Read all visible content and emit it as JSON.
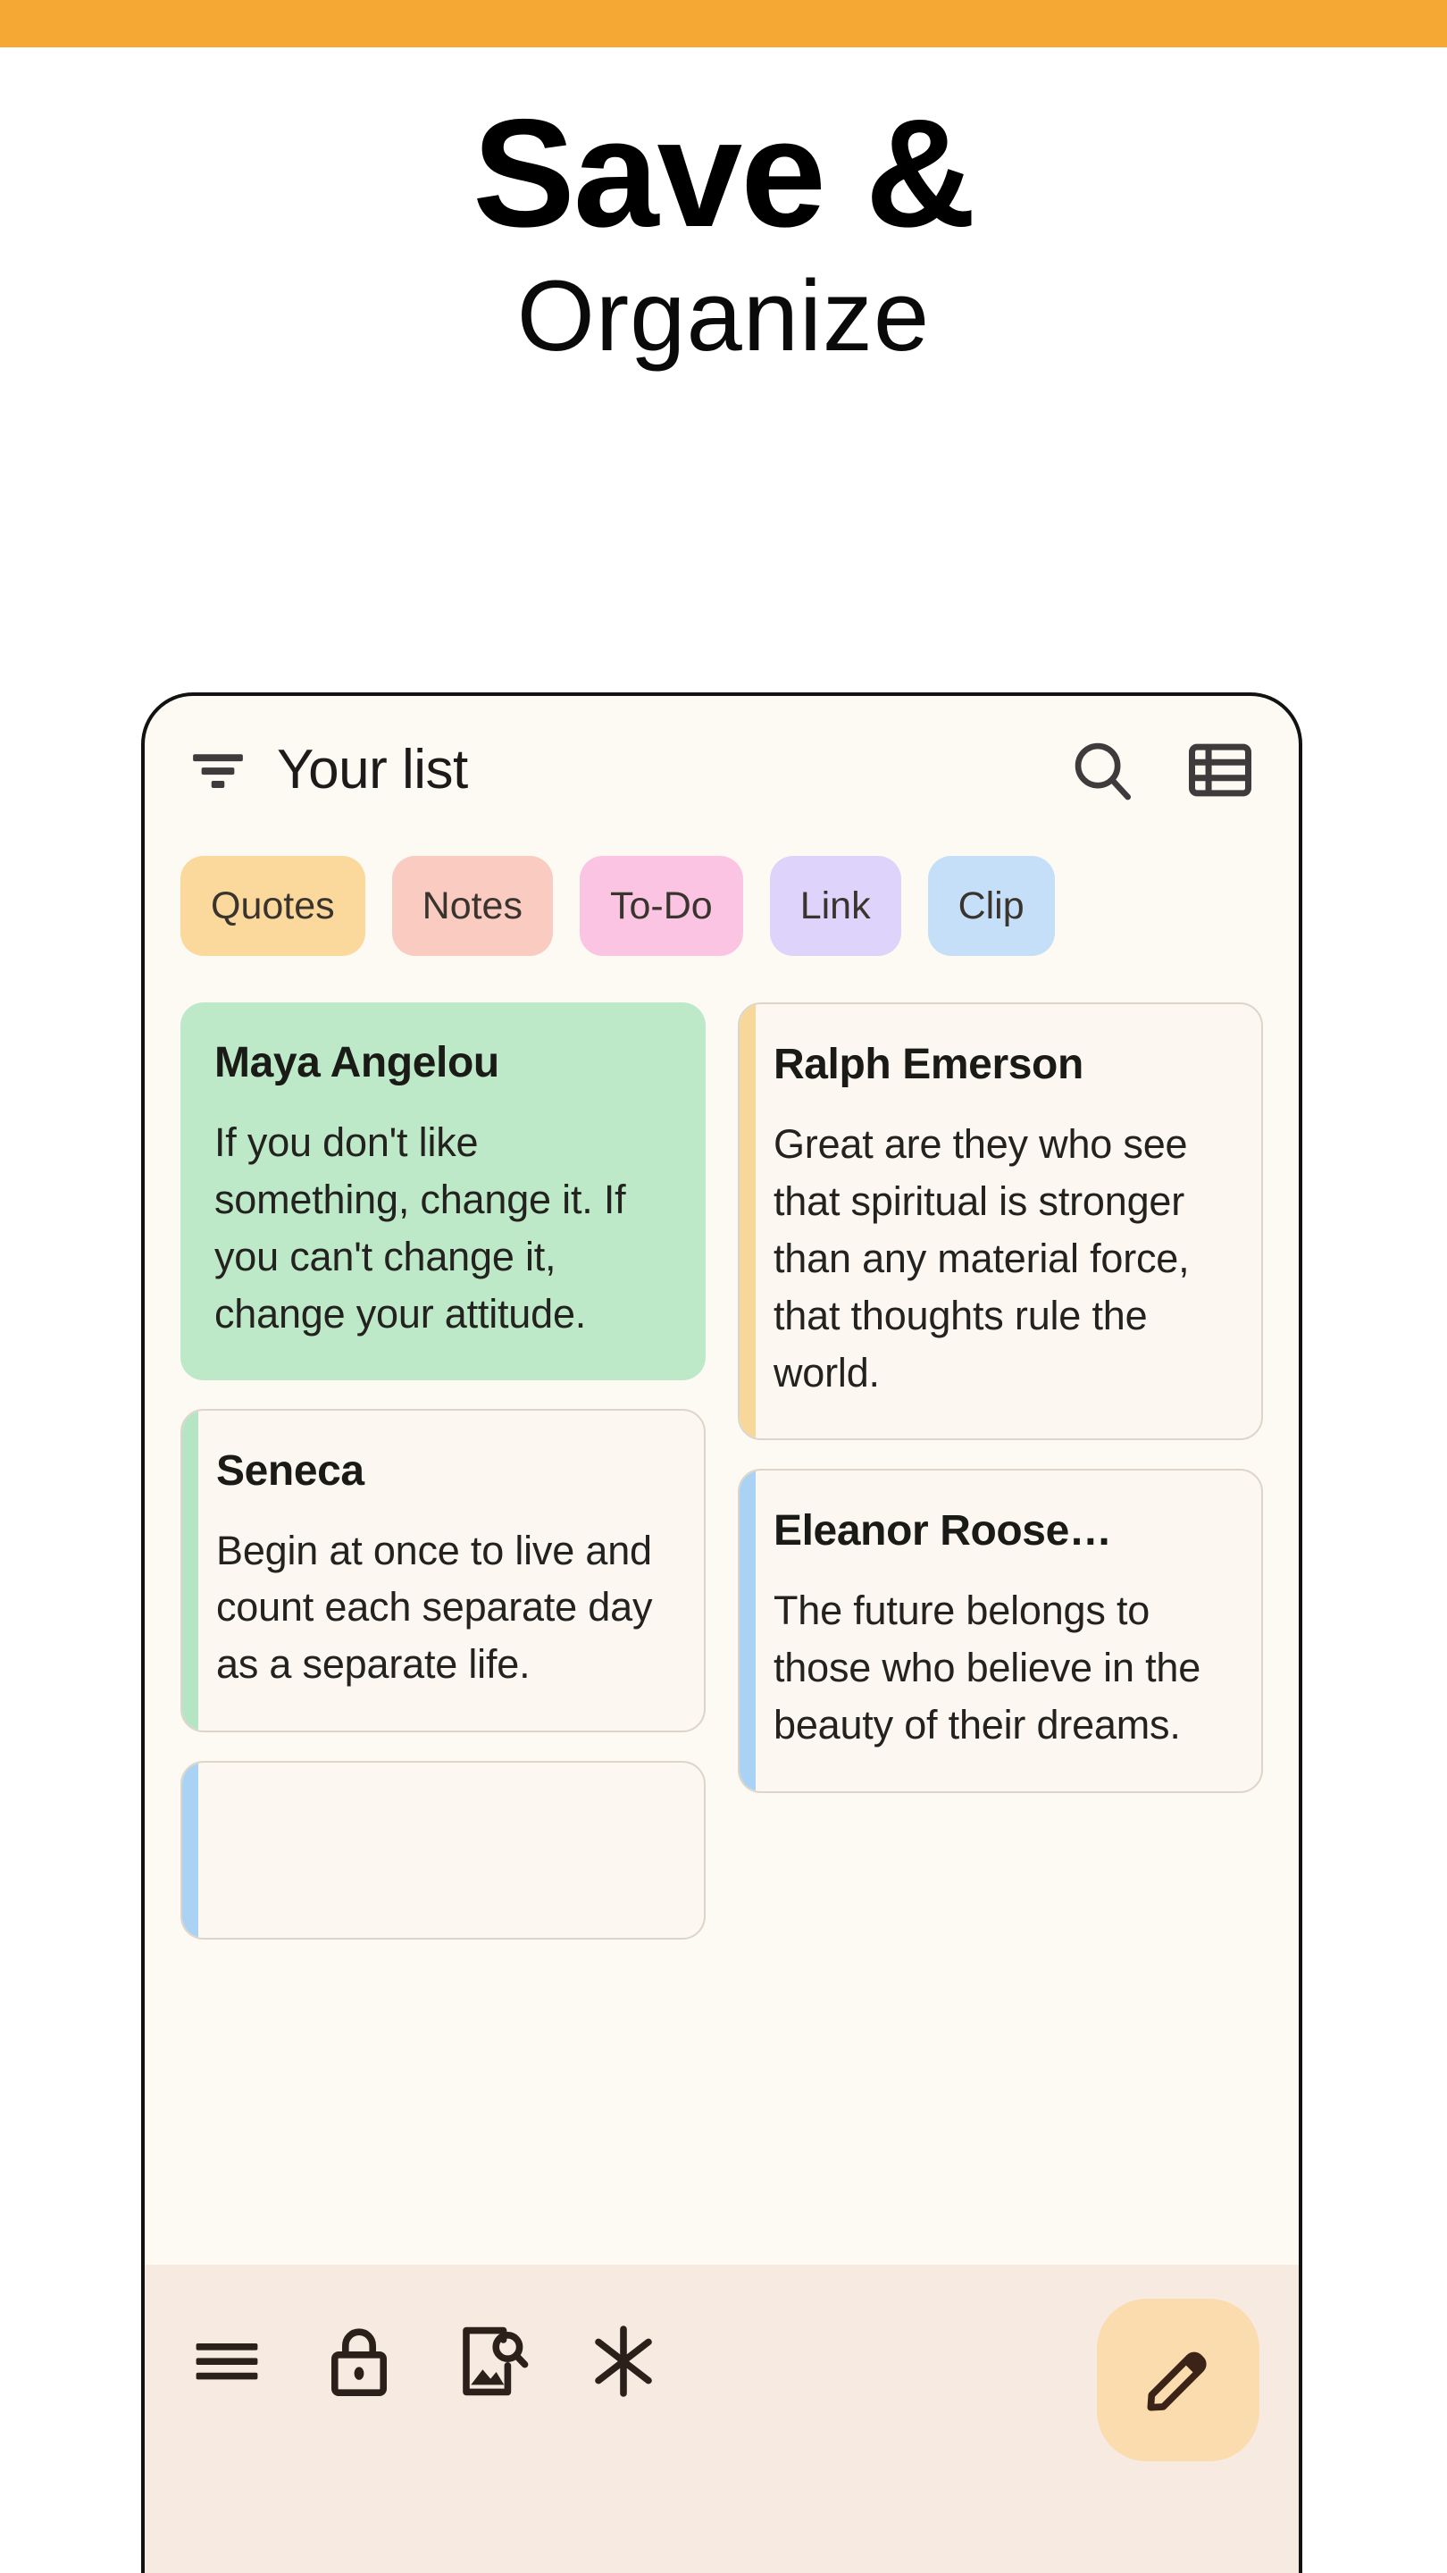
{
  "top_bar": {
    "color": "#F5A833"
  },
  "hero": {
    "line1": "Save &",
    "line2": "Organize"
  },
  "app": {
    "app_bar": {
      "filter_icon": "filter-list-icon",
      "title": "Your list",
      "search_icon": "search-icon",
      "view_icon": "list-view-icon"
    },
    "chips": [
      {
        "label": "Quotes",
        "color": "#FBD89B"
      },
      {
        "label": "Notes",
        "color": "#FACBC0"
      },
      {
        "label": "To-Do",
        "color": "#FBC4E2"
      },
      {
        "label": "Link",
        "color": "#DED3FB"
      },
      {
        "label": "Clip",
        "color": "#C5DFF8"
      }
    ],
    "cards": {
      "left_column": [
        {
          "title": "Maya Angelou",
          "body": "If you don't like something, change it. If you can't change it, change your attitude.",
          "style": "filled",
          "fill": "#BDE9C9",
          "stripe": ""
        },
        {
          "title": "Seneca",
          "body": "Begin at once to live and count each separate day as a separate life.",
          "style": "outlined",
          "fill": "#FCF8F1",
          "stripe": "#B6E5C6"
        },
        {
          "title": "",
          "body": "",
          "style": "outlined",
          "fill": "#FCF8F1",
          "stripe": "#A9D2F5"
        }
      ],
      "right_column": [
        {
          "title": "Ralph Emerson",
          "body": "Great are they who see that spiritual is stronger than any material force, that thoughts rule the world.",
          "style": "outlined",
          "fill": "#FCF8F1",
          "stripe": "#F8D79B"
        },
        {
          "title": "Eleanor Roose…",
          "body": "The future belongs to those who believe in the beauty of their dreams.",
          "style": "outlined",
          "fill": "#FCF8F1",
          "stripe": "#A9D2F5"
        }
      ]
    },
    "bottom_nav": {
      "items": [
        {
          "icon": "hamburger-menu-icon"
        },
        {
          "icon": "lock-icon"
        },
        {
          "icon": "image-search-icon"
        },
        {
          "icon": "sparkle-icon"
        }
      ],
      "fab": {
        "icon": "pencil-icon",
        "color": "#FBDCAF"
      },
      "background": "#F7EAE1"
    }
  }
}
